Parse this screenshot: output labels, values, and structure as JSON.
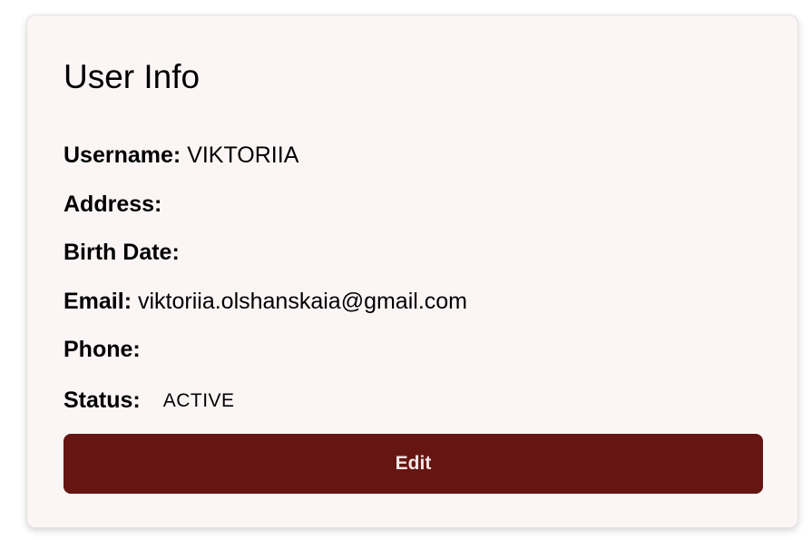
{
  "card": {
    "title": "User Info",
    "fields": {
      "username": {
        "label": "Username:",
        "value": "VIKTORIIA"
      },
      "address": {
        "label": "Address:",
        "value": ""
      },
      "birth_date": {
        "label": "Birth Date:",
        "value": ""
      },
      "email": {
        "label": "Email:",
        "value": "viktoriia.olshanskaia@gmail.com"
      },
      "phone": {
        "label": "Phone:",
        "value": ""
      },
      "status": {
        "label": "Status:",
        "value": "ACTIVE"
      }
    },
    "edit_label": "Edit"
  },
  "colors": {
    "card_background": "#fbf6f5",
    "button_background": "#661612",
    "button_text": "#f3e8e7"
  }
}
